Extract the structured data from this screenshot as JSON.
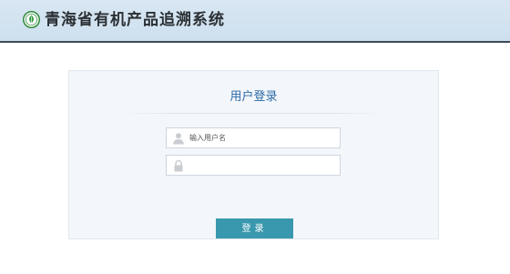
{
  "header": {
    "title": "青海省有机产品追溯系统",
    "logo_icon": "organic-leaf-logo-icon"
  },
  "login": {
    "title": "用户登录",
    "username": {
      "placeholder": "输入用户名",
      "value": "",
      "icon": "user-icon"
    },
    "password": {
      "placeholder": "",
      "value": "",
      "icon": "lock-icon"
    },
    "submit_label": "登录"
  },
  "colors": {
    "header_bg": "#d4e4f1",
    "header_border": "#3d4a57",
    "title_blue": "#2b6aa8",
    "button": "#3a98ae"
  }
}
